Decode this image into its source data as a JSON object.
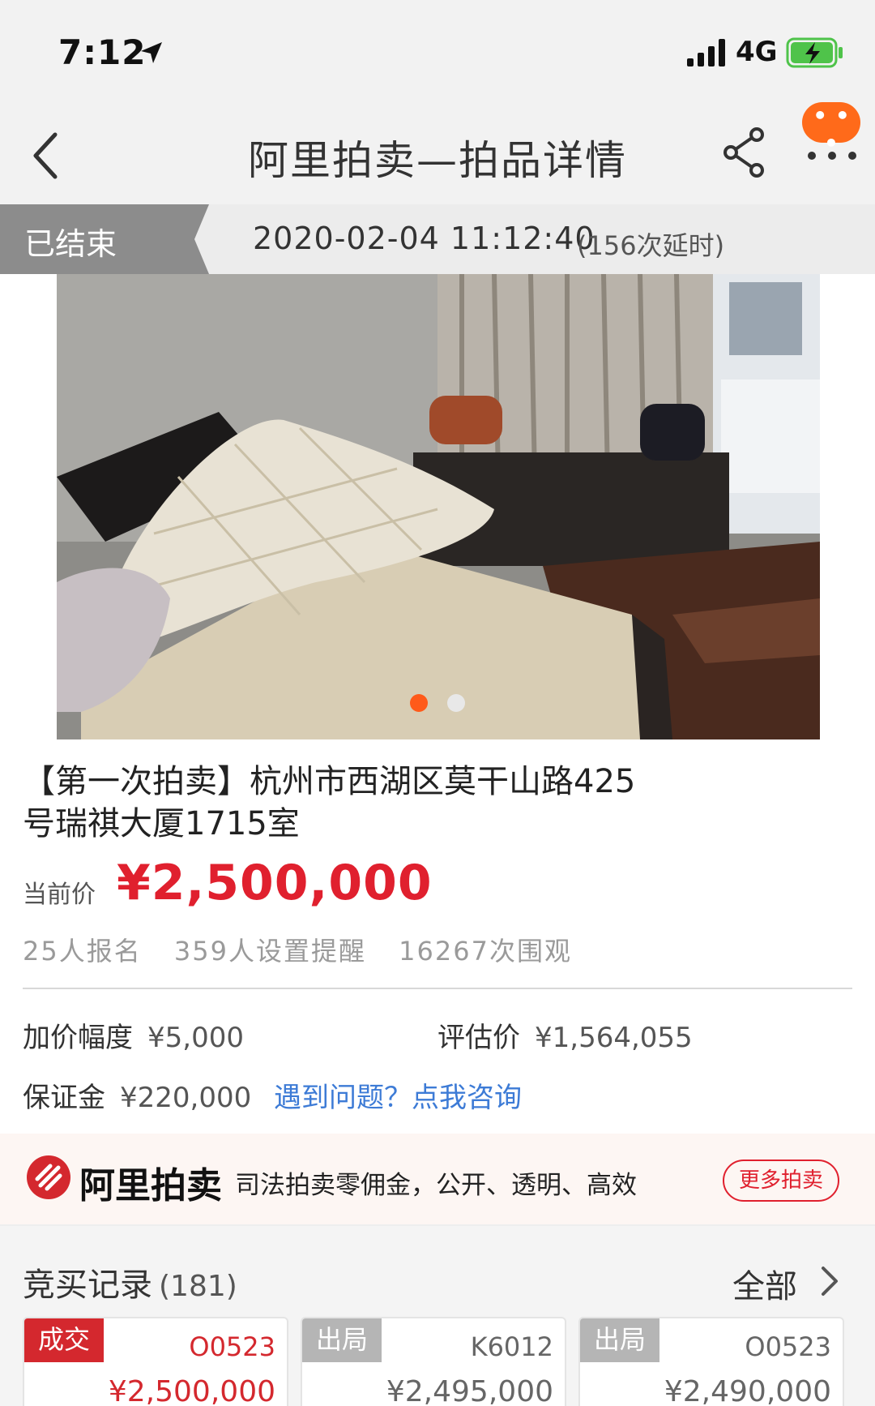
{
  "status_bar": {
    "time": "7:12",
    "network": "4G"
  },
  "nav": {
    "title": "阿里拍卖—拍品详情"
  },
  "auction_status": {
    "label": "已结束",
    "end_time": "2020-02-04 11:12:40",
    "extensions": "(156次延时)"
  },
  "gallery": {
    "current_index": 1,
    "total": 2
  },
  "lot": {
    "title": "【第一次拍卖】杭州市西湖区莫干山路425号瑞祺大厦1715室",
    "price_label": "当前价",
    "price": "¥2,500,000",
    "stats": [
      "25人报名",
      "359人设置提醒",
      "16267次围观"
    ]
  },
  "details": {
    "increment_label": "加价幅度",
    "increment": "¥5,000",
    "appraisal_label": "评估价",
    "appraisal": "¥1,564,055",
    "deposit_label": "保证金",
    "deposit": "¥220,000",
    "help_link": "遇到问题？点我咨询"
  },
  "banner": {
    "logo_text": "阿里拍卖",
    "slogan": "司法拍卖零佣金，公开、透明、高效",
    "button": "更多拍卖"
  },
  "records": {
    "title": "竞买记录",
    "count": "(181)",
    "all_label": "全部",
    "items": [
      {
        "status": "成交",
        "code": "O0523",
        "price": "¥2,500,000",
        "status_color": "#d4282e",
        "text_color": "#d4282e"
      },
      {
        "status": "出局",
        "code": "K6012",
        "price": "¥2,495,000",
        "status_color": "#b5b5b5",
        "text_color": "#666666"
      },
      {
        "status": "出局",
        "code": "O0523",
        "price": "¥2,490,000",
        "status_color": "#b5b5b5",
        "text_color": "#666666"
      }
    ]
  },
  "colors": {
    "accent_red": "#e0202e",
    "accent_orange": "#ff6a1a",
    "link_blue": "#3d7bd6"
  }
}
